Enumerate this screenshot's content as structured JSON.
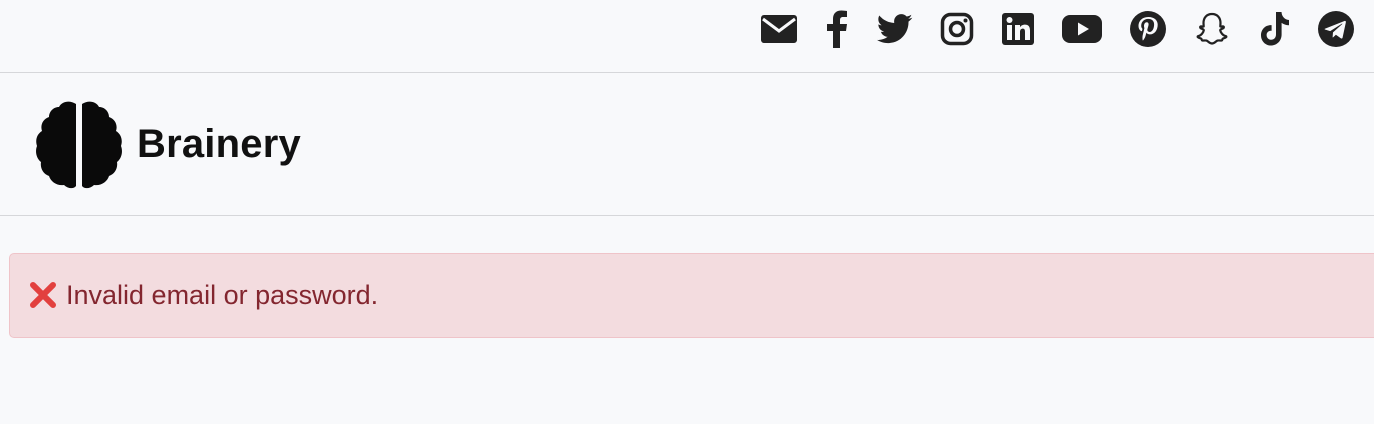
{
  "social_links": [
    {
      "name": "email-icon"
    },
    {
      "name": "facebook-icon"
    },
    {
      "name": "twitter-icon"
    },
    {
      "name": "instagram-icon"
    },
    {
      "name": "linkedin-icon"
    },
    {
      "name": "youtube-icon"
    },
    {
      "name": "pinterest-icon"
    },
    {
      "name": "snapchat-icon"
    },
    {
      "name": "tiktok-icon"
    },
    {
      "name": "telegram-icon"
    }
  ],
  "brand": {
    "name": "Brainery",
    "logo_icon": "brain-icon"
  },
  "alert": {
    "icon": "cross-mark-icon",
    "message": "Invalid email or password.",
    "background_color": "#f3dcdf",
    "text_color": "#83262f",
    "icon_color": "#e2403e"
  },
  "colors": {
    "page_background": "#f8f9fb",
    "icon_color": "#222222",
    "divider": "#d6d7da"
  }
}
